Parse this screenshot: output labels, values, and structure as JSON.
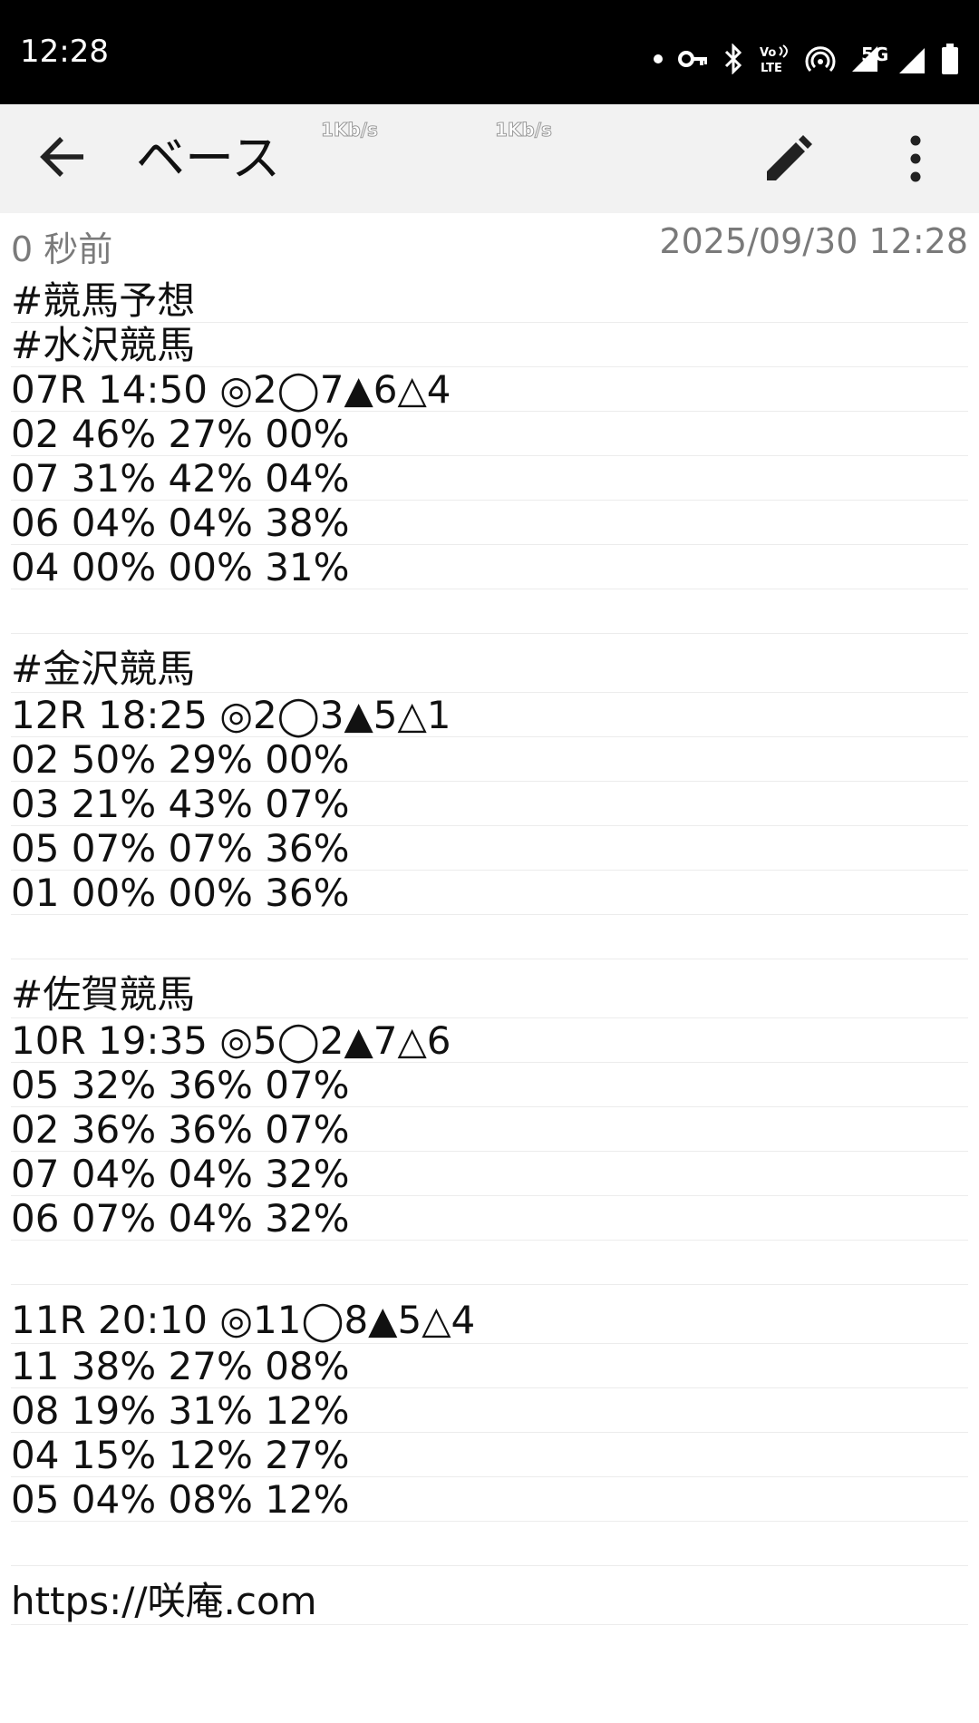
{
  "status_bar": {
    "time": "12:28",
    "network": "5G",
    "icons": [
      "notification-dot-icon",
      "vpn-key-icon",
      "bluetooth-icon",
      "volte-icon",
      "hotspot-icon",
      "cell-signal-icon",
      "5g-signal-icon",
      "battery-icon"
    ]
  },
  "app_bar": {
    "title": "ベース",
    "speed_left": "1Kb/s",
    "speed_right": "1Kb/s",
    "icons": [
      "back-arrow-icon",
      "pencil-icon",
      "more-vert-icon"
    ]
  },
  "meta": {
    "relative_time": "0 秒前",
    "datetime": "2025/09/30 12:28"
  },
  "note": {
    "lines": [
      "#競馬予想",
      "#水沢競馬",
      "07R 14:50 ◎2◯7▲6△4",
      "02 46% 27% 00%",
      "07 31% 42% 04%",
      "06 04% 04% 38%",
      "04 00% 00% 31%",
      "",
      "#金沢競馬",
      "12R 18:25 ◎2◯3▲5△1",
      "02 50% 29% 00%",
      "03 21% 43% 07%",
      "05 07% 07% 36%",
      "01 00% 00% 36%",
      "",
      "#佐賀競馬",
      "10R 19:35 ◎5◯2▲7△6",
      "05 32% 36% 07%",
      "02 36% 36% 07%",
      "07 04% 04% 32%",
      "06 07% 04% 32%",
      "",
      "11R 20:10 ◎11◯8▲5△4",
      "11 38% 27% 08%",
      "08 19% 31% 12%",
      "04 15% 12% 27%",
      "05 04% 08% 12%",
      "",
      "https://咲庵.com"
    ]
  }
}
